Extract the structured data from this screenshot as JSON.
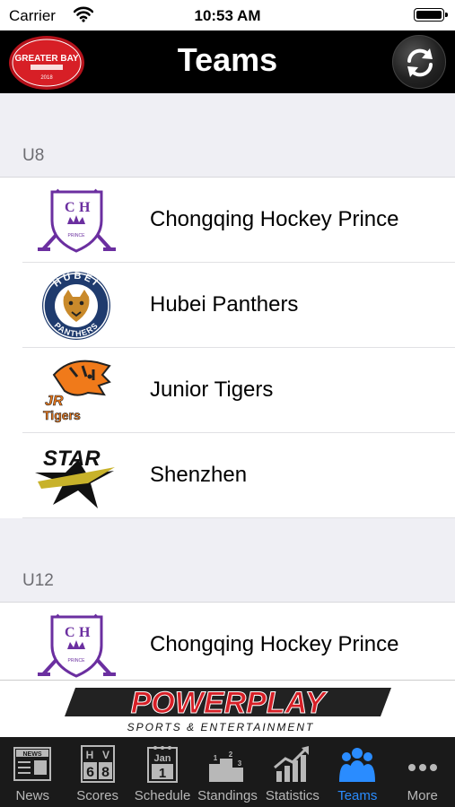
{
  "status_bar": {
    "carrier": "Carrier",
    "time": "10:53 AM"
  },
  "nav": {
    "title": "Teams",
    "logo_text": "GREATER BAY",
    "logo_year": "2018"
  },
  "sections": [
    {
      "header": "U8",
      "teams": [
        {
          "name": "Chongqing Hockey Prince",
          "logo": "chongqing-prince-logo"
        },
        {
          "name": "Hubei Panthers",
          "logo": "hubei-panthers-logo",
          "logo_top": "HUBEI",
          "logo_bottom": "PANTHERS"
        },
        {
          "name": "Junior Tigers",
          "logo": "junior-tigers-logo",
          "logo_text_1": "JR",
          "logo_text_2": "Tigers"
        },
        {
          "name": "Shenzhen",
          "logo": "shenzhen-star-logo",
          "logo_text": "STAR"
        }
      ]
    },
    {
      "header": "U12",
      "teams": [
        {
          "name": "Chongqing Hockey Prince",
          "logo": "chongqing-prince-logo"
        }
      ]
    }
  ],
  "ad": {
    "title": "POWERPLAY",
    "subtitle": "SPORTS & ENTERTAINMENT"
  },
  "tabs": [
    {
      "label": "News",
      "icon": "newspaper-icon"
    },
    {
      "label": "Scores",
      "icon": "scoreboard-icon",
      "icon_text": "H V 6 8"
    },
    {
      "label": "Schedule",
      "icon": "calendar-icon",
      "icon_month": "Jan",
      "icon_day": "1"
    },
    {
      "label": "Standings",
      "icon": "podium-icon"
    },
    {
      "label": "Statistics",
      "icon": "chart-icon"
    },
    {
      "label": "Teams",
      "icon": "people-icon",
      "active": true
    },
    {
      "label": "More",
      "icon": "more-icon"
    }
  ],
  "colors": {
    "active_tab": "#2a8cff",
    "nav_bg": "#000000",
    "tab_bg": "#1a1a1a"
  }
}
